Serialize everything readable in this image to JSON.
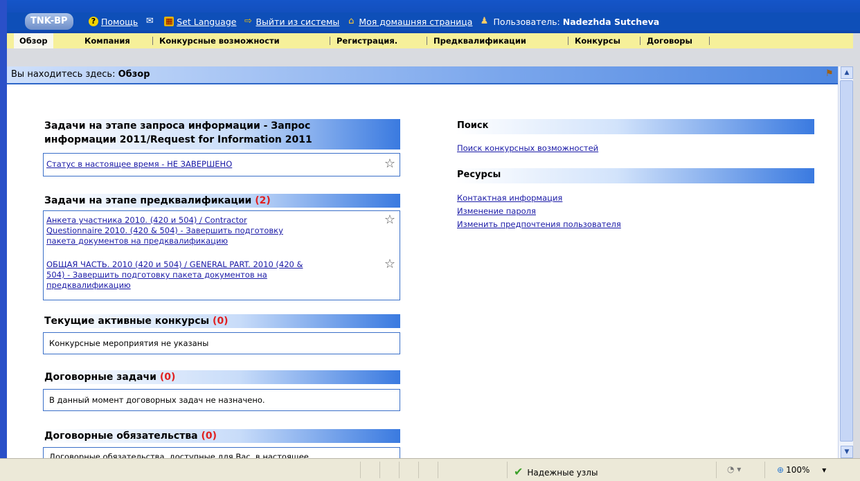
{
  "header": {
    "logo": "TNK-BP",
    "help": "Помощь",
    "set_language": "Set Language",
    "logout": "Выйти из системы",
    "home": "Моя домашняя страница",
    "user_label": "Пользователь:",
    "user_name": "Nadezhda Sutcheva"
  },
  "nav": {
    "tabs": [
      "Обзор",
      "Компания",
      "Конкурсные возможности",
      "Регистрация.",
      "Предквалификации",
      "Конкурсы",
      "Договоры"
    ],
    "active": "Обзор"
  },
  "breadcrumb": {
    "prefix": "Вы находитесь здесь:",
    "current": "Обзор"
  },
  "left": {
    "rfi": {
      "title_line1": "Задачи на этапе запроса информации - Запрос",
      "title_line2": "информации 2011/Request for Information 2011",
      "item": "Статус в настоящее время - НЕ ЗАВЕРШЕНО"
    },
    "prequal": {
      "title": "Задачи на этапе предквалификации",
      "count": "(2)",
      "item1_line1": "Анкета участника 2010. (420 и 504) / Contractor",
      "item1_line2": "Questionnaire 2010. (420 & 504) - Завершить подготовку",
      "item1_line3": "пакета документов на предквалификацию",
      "item2_line1": "ОБЩАЯ ЧАСТЬ. 2010 (420 и 504) / GENERAL PART. 2010 (420 &",
      "item2_line2": "504) - Завершить подготовку пакета документов на",
      "item2_line3": "предквалификацию"
    },
    "tenders": {
      "title": "Текущие активные конкурсы",
      "count": "(0)",
      "text": "Конкурсные мероприятия не указаны"
    },
    "contract_tasks": {
      "title": "Договорные задачи",
      "count": "(0)",
      "text": "В данный момент договорных задач не назначено."
    },
    "obligations": {
      "title": "Договорные обязательства",
      "count": "(0)",
      "text": "Договорные обязательства, доступные для Вас, в настоящее"
    }
  },
  "right": {
    "search": {
      "title": "Поиск",
      "link": "Поиск конкурсных возможностей"
    },
    "resources": {
      "title": "Ресурсы",
      "links": [
        "Контактная информация",
        "Изменение пароля",
        "Изменить предпочтения пользователя"
      ]
    }
  },
  "status": {
    "trusted": "Надежные узлы",
    "zoom": "100%"
  }
}
